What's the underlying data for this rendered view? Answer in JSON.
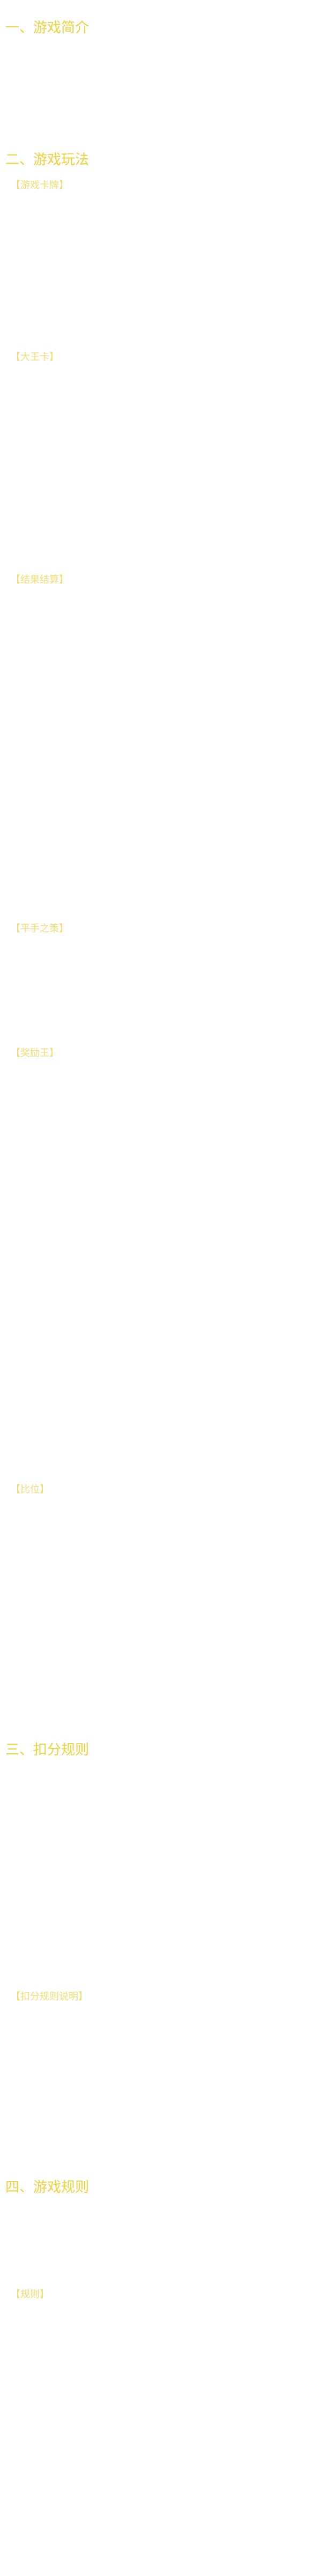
{
  "sections": [
    {
      "title": "一、游戏简介",
      "subsections": []
    },
    {
      "title": "二、游戏玩法",
      "subsections": [
        {
          "label": "【游戏卡牌】"
        },
        {
          "label": "【大王卡】"
        },
        {
          "label": "【结果结算】"
        },
        {
          "label": "【平手之策】"
        },
        {
          "label": "【奖励王】"
        },
        {
          "label": "【比位】"
        }
      ]
    },
    {
      "title": "三、扣分规则",
      "subsections": [
        {
          "label": "【扣分规则说明】"
        }
      ]
    },
    {
      "title": "四、游戏规则",
      "subsections": [
        {
          "label": "【规则】"
        }
      ]
    }
  ]
}
